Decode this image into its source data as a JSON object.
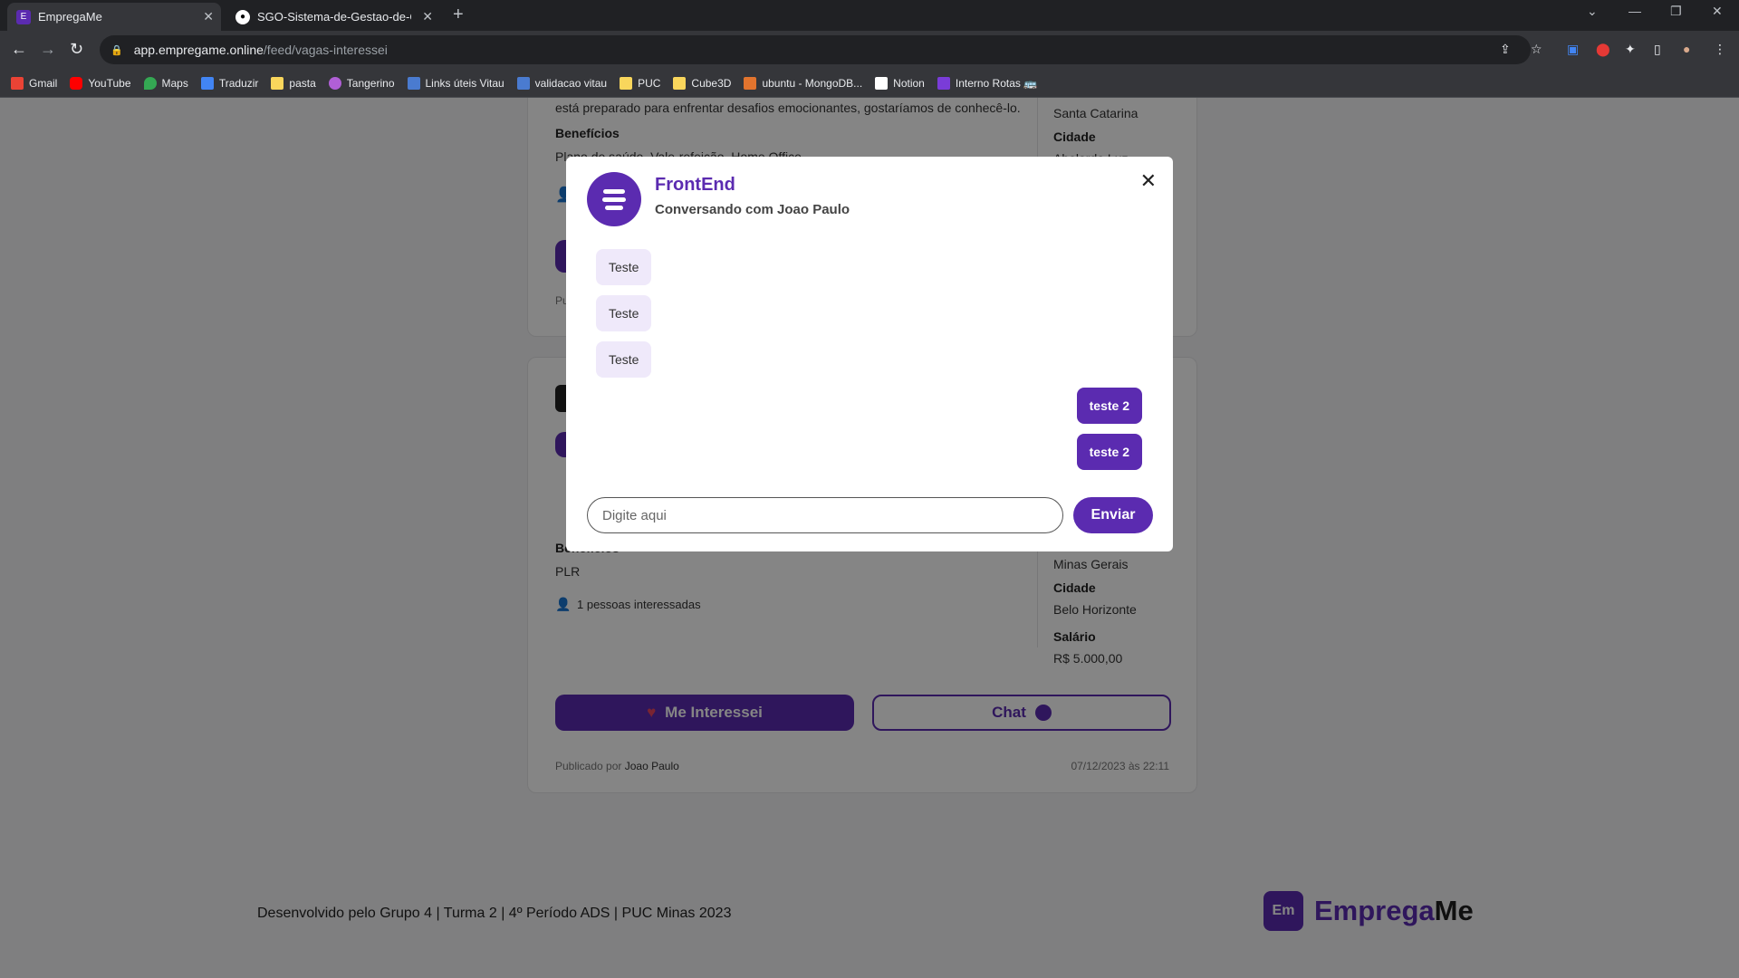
{
  "browser": {
    "tabs": [
      {
        "title": "EmpregaMe",
        "active": true
      },
      {
        "title": "SGO-Sistema-de-Gestao-de-ON",
        "active": false
      }
    ],
    "url_host": "app.empregame.online",
    "url_path": "/feed/vagas-interessei",
    "bookmarks": [
      {
        "label": "Gmail",
        "color": "#ea4335"
      },
      {
        "label": "YouTube",
        "color": "#ff0000"
      },
      {
        "label": "Maps",
        "color": "#34a853"
      },
      {
        "label": "Traduzir",
        "color": "#4285f4"
      },
      {
        "label": "pasta",
        "color": "#f9d65c"
      },
      {
        "label": "Tangerino",
        "color": "#b05fd6"
      },
      {
        "label": "Links úteis Vitau",
        "color": "#4a7bd0"
      },
      {
        "label": "validacao vitau",
        "color": "#4a7bd0"
      },
      {
        "label": "PUC",
        "color": "#f9d65c"
      },
      {
        "label": "Cube3D",
        "color": "#f9d65c"
      },
      {
        "label": "ubuntu - MongoDB...",
        "color": "#e2742e"
      },
      {
        "label": "Notion",
        "color": "#ffffff"
      },
      {
        "label": "Interno Rotas 🚌",
        "color": "#7a3cd8"
      }
    ]
  },
  "card1": {
    "description_tail": "está preparado para enfrentar desafios emocionantes, gostaríamos de conhecê-lo.",
    "benefits_label": "Benefícios",
    "benefits_value": "Plano de saúde, Vale-refeição, Home Office",
    "state_value": "Santa Catarina",
    "city_label": "Cidade",
    "city_value": "Abelardo Luz",
    "published_partial": "Pu"
  },
  "card2": {
    "benefits_label": "Benefícios",
    "benefits_value": "PLR",
    "interested": "1 pessoas interessadas",
    "state_value": "Minas Gerais",
    "city_label": "Cidade",
    "city_value": "Belo Horizonte",
    "salary_label": "Salário",
    "salary_value": "R$ 5.000,00",
    "interest_button": "Me Interessei",
    "chat_button": "Chat",
    "published_by_label": "Publicado por",
    "published_by": "Joao Paulo",
    "date": "07/12/2023 às 22:11"
  },
  "footer": {
    "credits": "Desenvolvido pelo Grupo 4 | Turma 2 | 4º Período ADS | PUC Minas 2023",
    "brand_logo": "Em",
    "brand_main": "Emprega",
    "brand_me": "Me"
  },
  "chat_modal": {
    "title": "FrontEnd",
    "subtitle": "Conversando com Joao Paulo",
    "messages": [
      {
        "text": "Teste",
        "direction": "in"
      },
      {
        "text": "Teste",
        "direction": "in"
      },
      {
        "text": "Teste",
        "direction": "in"
      },
      {
        "text": "teste 2",
        "direction": "out"
      },
      {
        "text": "teste 2",
        "direction": "out"
      }
    ],
    "input_placeholder": "Digite aqui",
    "send_label": "Enviar"
  },
  "colors": {
    "primary": "#5b2bb0",
    "bubble_in": "#efe9fa"
  }
}
